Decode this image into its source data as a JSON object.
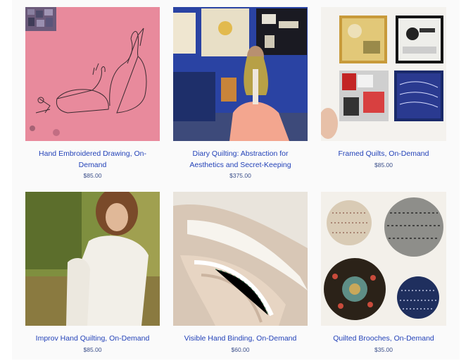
{
  "products": [
    {
      "title": "Hand Embroidered Drawing, On-Demand",
      "price": "$85.00"
    },
    {
      "title": "Diary Quilting: Abstraction for Aesthetics and Secret-Keeping",
      "price": "$375.00"
    },
    {
      "title": "Framed Quilts, On-Demand",
      "price": "$85.00"
    },
    {
      "title": "Improv Hand Quilting, On-Demand",
      "price": "$85.00"
    },
    {
      "title": "Visible Hand Binding, On-Demand",
      "price": "$60.00"
    },
    {
      "title": "Quilted Brooches, On-Demand",
      "price": "$35.00"
    }
  ],
  "colors": {
    "link": "#2342b8",
    "price": "#3b4f8a",
    "background": "#fafafa"
  }
}
